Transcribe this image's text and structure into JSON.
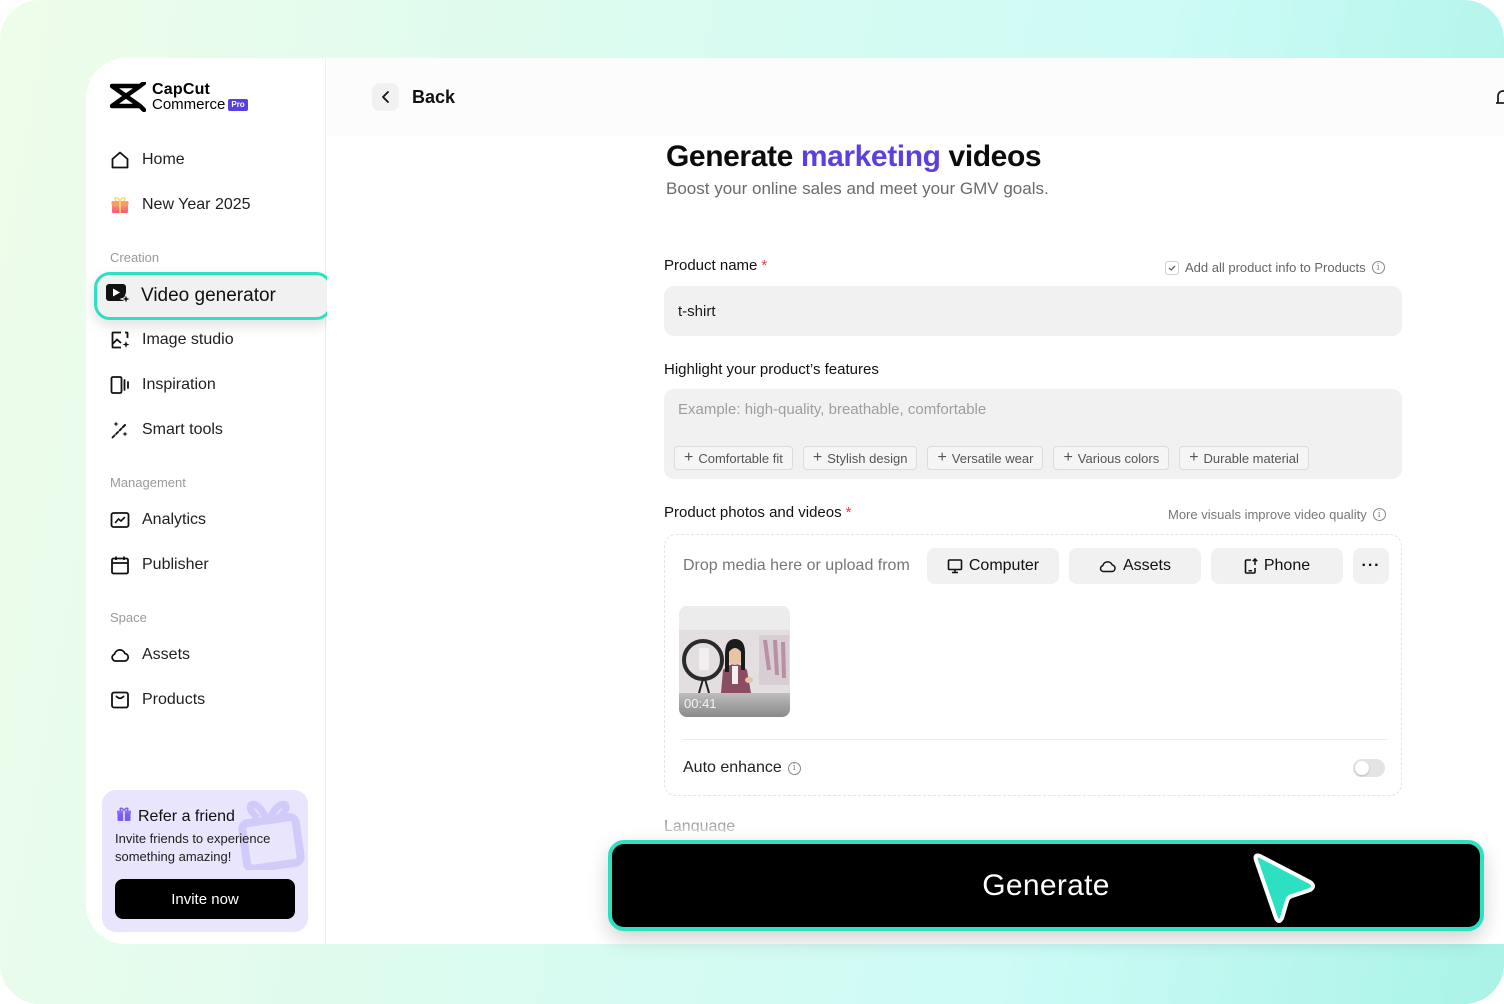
{
  "brand": {
    "name_line1": "CapCut",
    "name_line2": "Commerce",
    "badge": "Pro"
  },
  "sidebar": {
    "top_items": [
      {
        "label": "Home",
        "icon": "home-icon"
      },
      {
        "label": "New Year 2025",
        "icon": "gift-icon"
      }
    ],
    "sections": [
      {
        "label": "Creation"
      },
      {
        "label": "Management"
      },
      {
        "label": "Space"
      }
    ],
    "creation_items": [
      {
        "label": "Video generator",
        "icon": "video-sparkle-icon",
        "active": true
      },
      {
        "label": "Image studio",
        "icon": "image-sparkle-icon"
      },
      {
        "label": "Inspiration",
        "icon": "inspiration-icon"
      },
      {
        "label": "Smart tools",
        "icon": "magic-wand-icon"
      }
    ],
    "management_items": [
      {
        "label": "Analytics",
        "icon": "analytics-icon"
      },
      {
        "label": "Publisher",
        "icon": "calendar-icon"
      }
    ],
    "space_items": [
      {
        "label": "Assets",
        "icon": "cloud-icon"
      },
      {
        "label": "Products",
        "icon": "box-icon"
      }
    ],
    "refer": {
      "title": "Refer a friend",
      "description": "Invite friends to experience something amazing!",
      "button": "Invite now"
    }
  },
  "header": {
    "back_label": "Back"
  },
  "page": {
    "title_pre": "Generate ",
    "title_accent": "marketing",
    "title_post": " videos",
    "subtitle": "Boost your online sales and meet your GMV goals.",
    "accent_color": "#5d3fe0"
  },
  "form": {
    "product_name": {
      "label": "Product name",
      "required_mark": "*",
      "value": "t-shirt",
      "add_info_label": "Add all product info to Products",
      "add_info_checked": true
    },
    "features": {
      "label": "Highlight your product’s features",
      "placeholder": "Example: high-quality, breathable, comfortable",
      "value": "",
      "suggestions": [
        "Comfortable fit",
        "Stylish design",
        "Versatile wear",
        "Various colors",
        "Durable material"
      ]
    },
    "media": {
      "label": "Product photos and videos",
      "required_mark": "*",
      "hint": "More visuals improve video quality",
      "drop_text": "Drop media here or upload from",
      "buttons": [
        {
          "label": "Computer",
          "icon": "monitor-icon"
        },
        {
          "label": "Assets",
          "icon": "cloud-icon"
        },
        {
          "label": "Phone",
          "icon": "phone-upload-icon"
        }
      ],
      "more_label": "···",
      "items": [
        {
          "type": "video",
          "duration": "00:41"
        }
      ],
      "auto_enhance_label": "Auto enhance",
      "auto_enhance_on": false
    },
    "language": {
      "label": "Language"
    },
    "generate_label": "Generate"
  },
  "colors": {
    "highlight_border": "#2ee0c2",
    "required": "#f0384f",
    "pro_badge": "#5b3fe0"
  }
}
